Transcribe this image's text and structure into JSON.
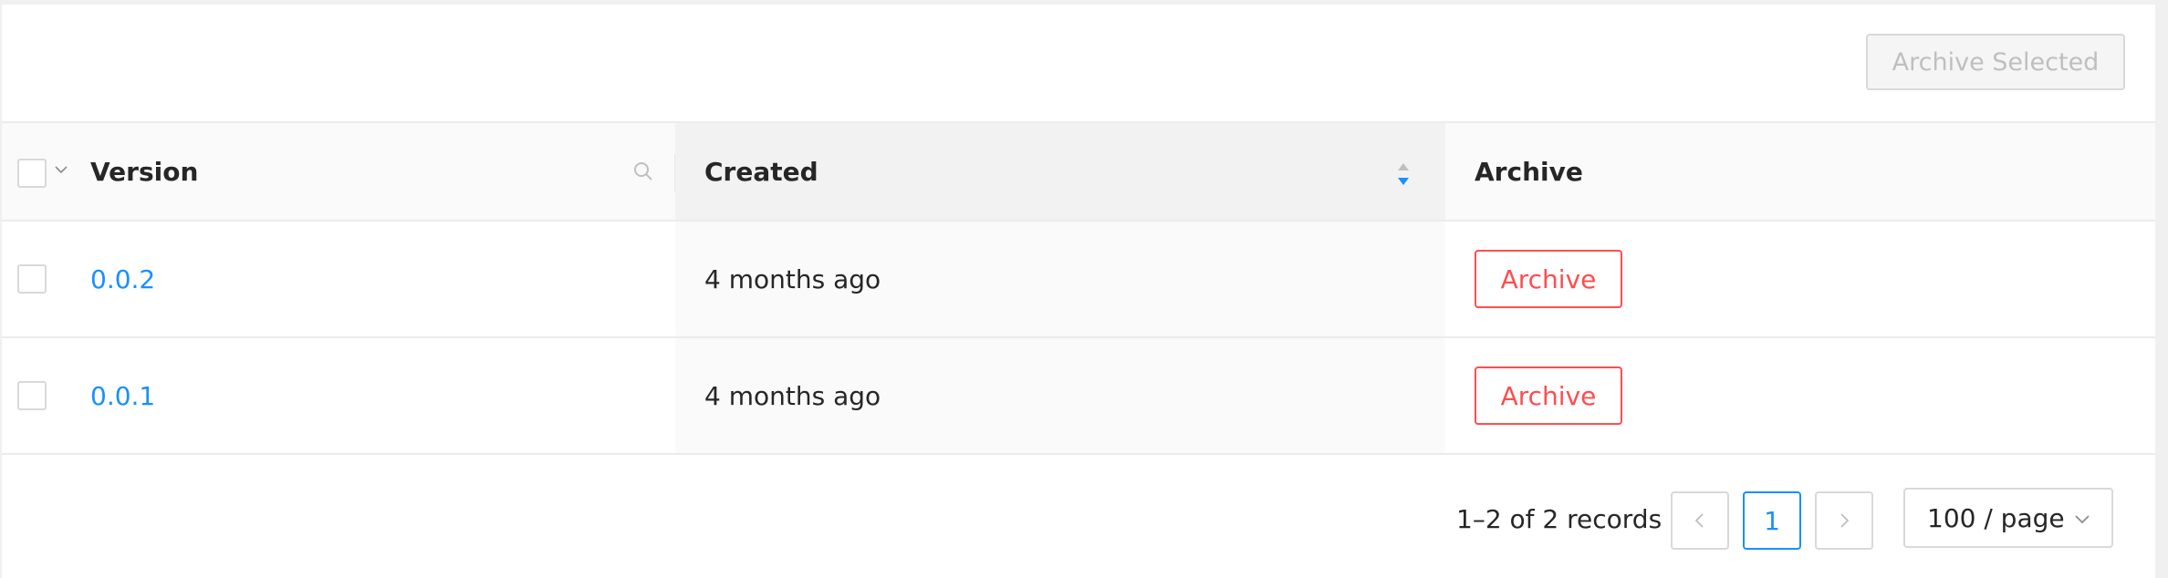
{
  "toolbar": {
    "archive_selected_label": "Archive Selected"
  },
  "table": {
    "columns": {
      "version": "Version",
      "created": "Created",
      "archive": "Archive"
    },
    "rows": [
      {
        "version": "0.0.2",
        "created": "4 months ago",
        "action": "Archive"
      },
      {
        "version": "0.0.1",
        "created": "4 months ago",
        "action": "Archive"
      }
    ]
  },
  "pagination": {
    "total_text": "1–2 of 2 records",
    "current_page": "1",
    "page_size": "100 / page"
  },
  "icons": [
    "chevron-down-icon",
    "search-icon",
    "sort-icon",
    "chevron-left-icon",
    "chevron-right-icon"
  ],
  "colors": {
    "link": "#1890ff",
    "danger": "#ff4d4f",
    "border": "#d9d9d9"
  }
}
